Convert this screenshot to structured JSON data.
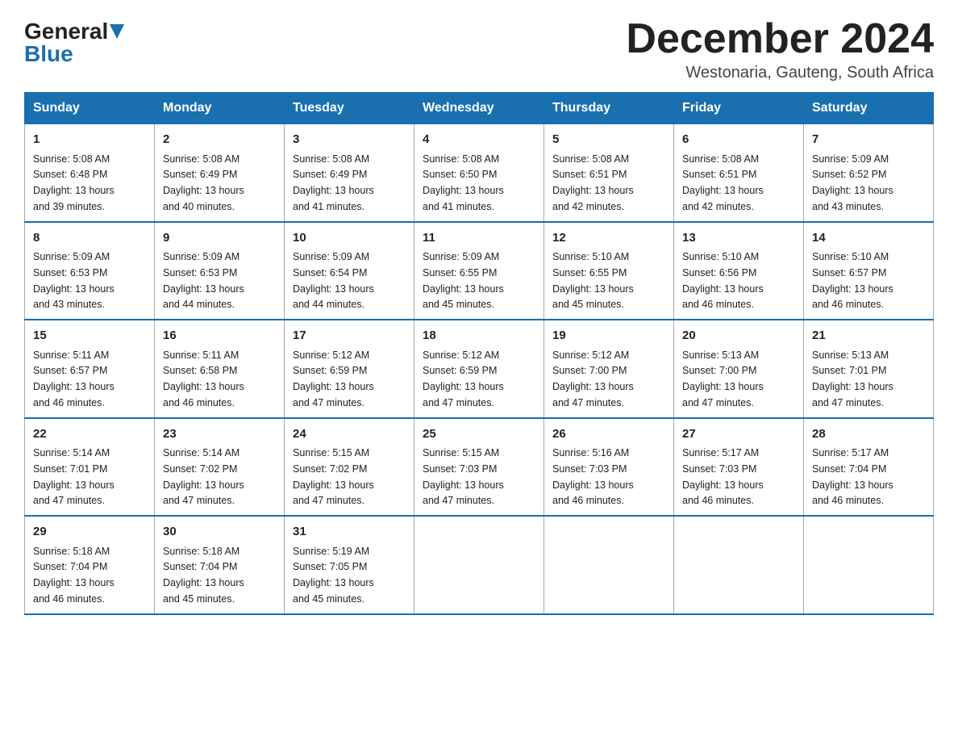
{
  "header": {
    "logo_line1": "General",
    "logo_line2": "Blue",
    "month_title": "December 2024",
    "location": "Westonaria, Gauteng, South Africa"
  },
  "days_of_week": [
    "Sunday",
    "Monday",
    "Tuesday",
    "Wednesday",
    "Thursday",
    "Friday",
    "Saturday"
  ],
  "weeks": [
    [
      {
        "day": "1",
        "sunrise": "5:08 AM",
        "sunset": "6:48 PM",
        "daylight": "13 hours and 39 minutes."
      },
      {
        "day": "2",
        "sunrise": "5:08 AM",
        "sunset": "6:49 PM",
        "daylight": "13 hours and 40 minutes."
      },
      {
        "day": "3",
        "sunrise": "5:08 AM",
        "sunset": "6:49 PM",
        "daylight": "13 hours and 41 minutes."
      },
      {
        "day": "4",
        "sunrise": "5:08 AM",
        "sunset": "6:50 PM",
        "daylight": "13 hours and 41 minutes."
      },
      {
        "day": "5",
        "sunrise": "5:08 AM",
        "sunset": "6:51 PM",
        "daylight": "13 hours and 42 minutes."
      },
      {
        "day": "6",
        "sunrise": "5:08 AM",
        "sunset": "6:51 PM",
        "daylight": "13 hours and 42 minutes."
      },
      {
        "day": "7",
        "sunrise": "5:09 AM",
        "sunset": "6:52 PM",
        "daylight": "13 hours and 43 minutes."
      }
    ],
    [
      {
        "day": "8",
        "sunrise": "5:09 AM",
        "sunset": "6:53 PM",
        "daylight": "13 hours and 43 minutes."
      },
      {
        "day": "9",
        "sunrise": "5:09 AM",
        "sunset": "6:53 PM",
        "daylight": "13 hours and 44 minutes."
      },
      {
        "day": "10",
        "sunrise": "5:09 AM",
        "sunset": "6:54 PM",
        "daylight": "13 hours and 44 minutes."
      },
      {
        "day": "11",
        "sunrise": "5:09 AM",
        "sunset": "6:55 PM",
        "daylight": "13 hours and 45 minutes."
      },
      {
        "day": "12",
        "sunrise": "5:10 AM",
        "sunset": "6:55 PM",
        "daylight": "13 hours and 45 minutes."
      },
      {
        "day": "13",
        "sunrise": "5:10 AM",
        "sunset": "6:56 PM",
        "daylight": "13 hours and 46 minutes."
      },
      {
        "day": "14",
        "sunrise": "5:10 AM",
        "sunset": "6:57 PM",
        "daylight": "13 hours and 46 minutes."
      }
    ],
    [
      {
        "day": "15",
        "sunrise": "5:11 AM",
        "sunset": "6:57 PM",
        "daylight": "13 hours and 46 minutes."
      },
      {
        "day": "16",
        "sunrise": "5:11 AM",
        "sunset": "6:58 PM",
        "daylight": "13 hours and 46 minutes."
      },
      {
        "day": "17",
        "sunrise": "5:12 AM",
        "sunset": "6:59 PM",
        "daylight": "13 hours and 47 minutes."
      },
      {
        "day": "18",
        "sunrise": "5:12 AM",
        "sunset": "6:59 PM",
        "daylight": "13 hours and 47 minutes."
      },
      {
        "day": "19",
        "sunrise": "5:12 AM",
        "sunset": "7:00 PM",
        "daylight": "13 hours and 47 minutes."
      },
      {
        "day": "20",
        "sunrise": "5:13 AM",
        "sunset": "7:00 PM",
        "daylight": "13 hours and 47 minutes."
      },
      {
        "day": "21",
        "sunrise": "5:13 AM",
        "sunset": "7:01 PM",
        "daylight": "13 hours and 47 minutes."
      }
    ],
    [
      {
        "day": "22",
        "sunrise": "5:14 AM",
        "sunset": "7:01 PM",
        "daylight": "13 hours and 47 minutes."
      },
      {
        "day": "23",
        "sunrise": "5:14 AM",
        "sunset": "7:02 PM",
        "daylight": "13 hours and 47 minutes."
      },
      {
        "day": "24",
        "sunrise": "5:15 AM",
        "sunset": "7:02 PM",
        "daylight": "13 hours and 47 minutes."
      },
      {
        "day": "25",
        "sunrise": "5:15 AM",
        "sunset": "7:03 PM",
        "daylight": "13 hours and 47 minutes."
      },
      {
        "day": "26",
        "sunrise": "5:16 AM",
        "sunset": "7:03 PM",
        "daylight": "13 hours and 46 minutes."
      },
      {
        "day": "27",
        "sunrise": "5:17 AM",
        "sunset": "7:03 PM",
        "daylight": "13 hours and 46 minutes."
      },
      {
        "day": "28",
        "sunrise": "5:17 AM",
        "sunset": "7:04 PM",
        "daylight": "13 hours and 46 minutes."
      }
    ],
    [
      {
        "day": "29",
        "sunrise": "5:18 AM",
        "sunset": "7:04 PM",
        "daylight": "13 hours and 46 minutes."
      },
      {
        "day": "30",
        "sunrise": "5:18 AM",
        "sunset": "7:04 PM",
        "daylight": "13 hours and 45 minutes."
      },
      {
        "day": "31",
        "sunrise": "5:19 AM",
        "sunset": "7:05 PM",
        "daylight": "13 hours and 45 minutes."
      },
      null,
      null,
      null,
      null
    ]
  ],
  "labels": {
    "sunrise": "Sunrise:",
    "sunset": "Sunset:",
    "daylight": "Daylight:"
  }
}
